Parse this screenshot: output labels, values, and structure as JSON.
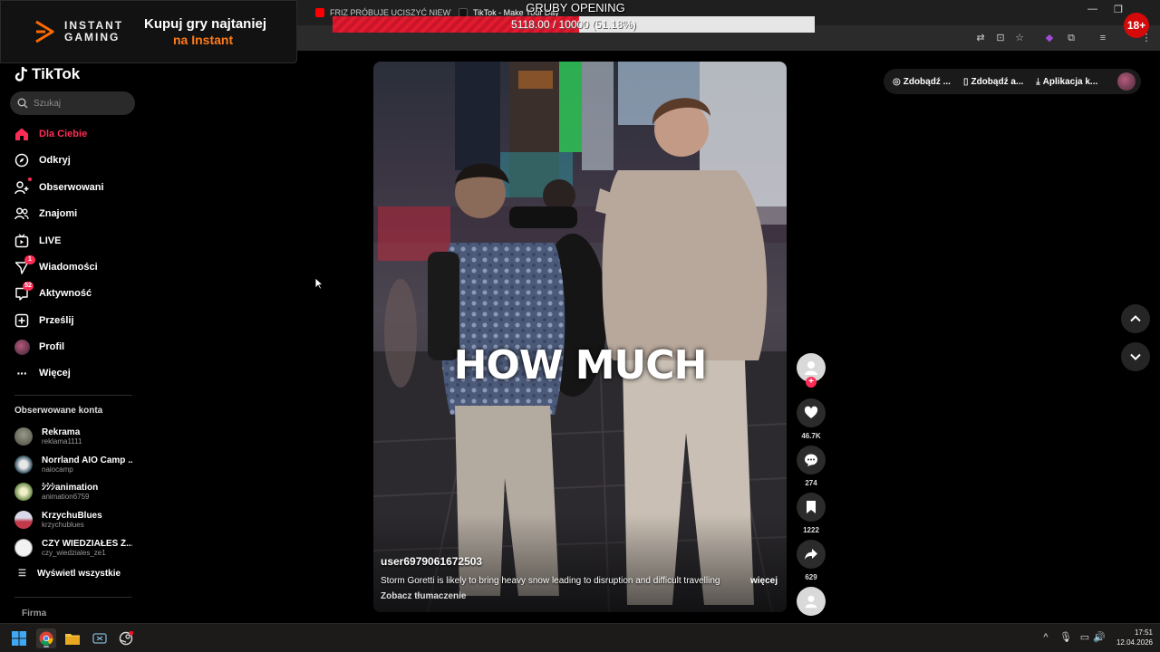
{
  "browser": {
    "tabs": [
      {
        "label": "FRIZ PRÓBUJE UCISZYĆ NIEWY",
        "close": "×"
      },
      {
        "label": "TikTok - Make Your Day",
        "close": "×"
      }
    ]
  },
  "overlay_ad": {
    "brand_line1": "INSTANT",
    "brand_line2": "GAMING",
    "headline": "Kupuj gry najtaniej",
    "subline": "na Instant",
    "accent": "#ff7a1a"
  },
  "stream_goal": {
    "title": "GRUBY OPENING",
    "progress_text": "5118.00 / 10000 (51.18%)",
    "fraction": 0.5118,
    "fill_color": "#e31b2e"
  },
  "age_badge": "18+",
  "tiktok": {
    "logo_text": "TikTok",
    "search_placeholder": "Szukaj",
    "accent": "#fe2c55",
    "nav": [
      {
        "label": "Dla Ciebie",
        "icon": "home-icon",
        "active": true
      },
      {
        "label": "Odkryj",
        "icon": "compass-icon"
      },
      {
        "label": "Obserwowani",
        "icon": "following-icon"
      },
      {
        "label": "Znajomi",
        "icon": "friends-icon"
      },
      {
        "label": "LIVE",
        "icon": "live-icon"
      },
      {
        "label": "Wiadomości",
        "icon": "messages-icon",
        "badge": "1"
      },
      {
        "label": "Aktywność",
        "icon": "activity-icon",
        "badge": "52"
      },
      {
        "label": "Prześlij",
        "icon": "upload-icon"
      },
      {
        "label": "Profil",
        "icon": "profile-icon"
      },
      {
        "label": "Więcej",
        "icon": "more-icon"
      }
    ],
    "followed_title": "Obserwowane konta",
    "accounts": [
      {
        "name": "Rekrama",
        "handle": "reklama1111"
      },
      {
        "name": "Norrland AIO Camp ...",
        "handle": "naiocamp"
      },
      {
        "name": "ｼｼｼanimation",
        "handle": "animation6759"
      },
      {
        "name": "KrzychuBlues",
        "handle": "krzychublues"
      },
      {
        "name": "CZY WIEDZIAŁEŚ Ż...",
        "handle": "czy_wiedziales_ze1"
      }
    ],
    "show_all": "Wyświetl wszystkie",
    "footer_section": "Firma"
  },
  "top_actions": [
    {
      "label": "Zdobądź ...",
      "icon": "coin-icon"
    },
    {
      "label": "Zdobądź a...",
      "icon": "phone-icon"
    },
    {
      "label": "Aplikacja k...",
      "icon": "download-icon"
    }
  ],
  "video": {
    "caption": "HOW MUCH",
    "username": "user6979061672503",
    "description": "Storm Goretti is likely to bring heavy snow leading to disruption and difficult travelling",
    "more": "więcej",
    "translate": "Zobacz tłumaczenie"
  },
  "actions": {
    "likes": "46.7K",
    "comments": "274",
    "saves": "1222",
    "shares": "629"
  },
  "taskbar": {
    "time": "17:51",
    "date": "12.04.2026"
  }
}
